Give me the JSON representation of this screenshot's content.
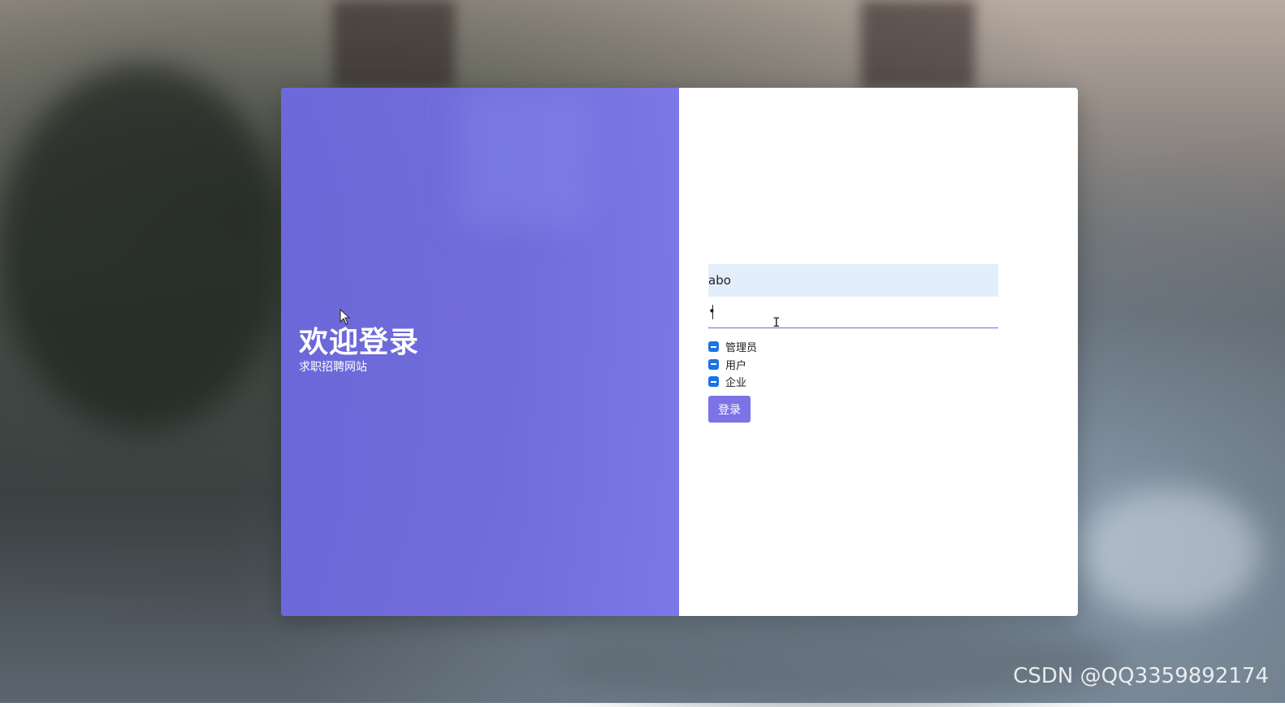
{
  "left_panel": {
    "title": "欢迎登录",
    "subtitle": "求职招聘网站",
    "color": "#736fe0"
  },
  "form": {
    "username_value": "abo",
    "password_value": "•",
    "roles": [
      {
        "label": "管理员"
      },
      {
        "label": "用户"
      },
      {
        "label": "企业"
      }
    ],
    "login_label": "登录",
    "accent_color": "#7b73e6"
  },
  "watermark": "CSDN @QQ3359892174"
}
